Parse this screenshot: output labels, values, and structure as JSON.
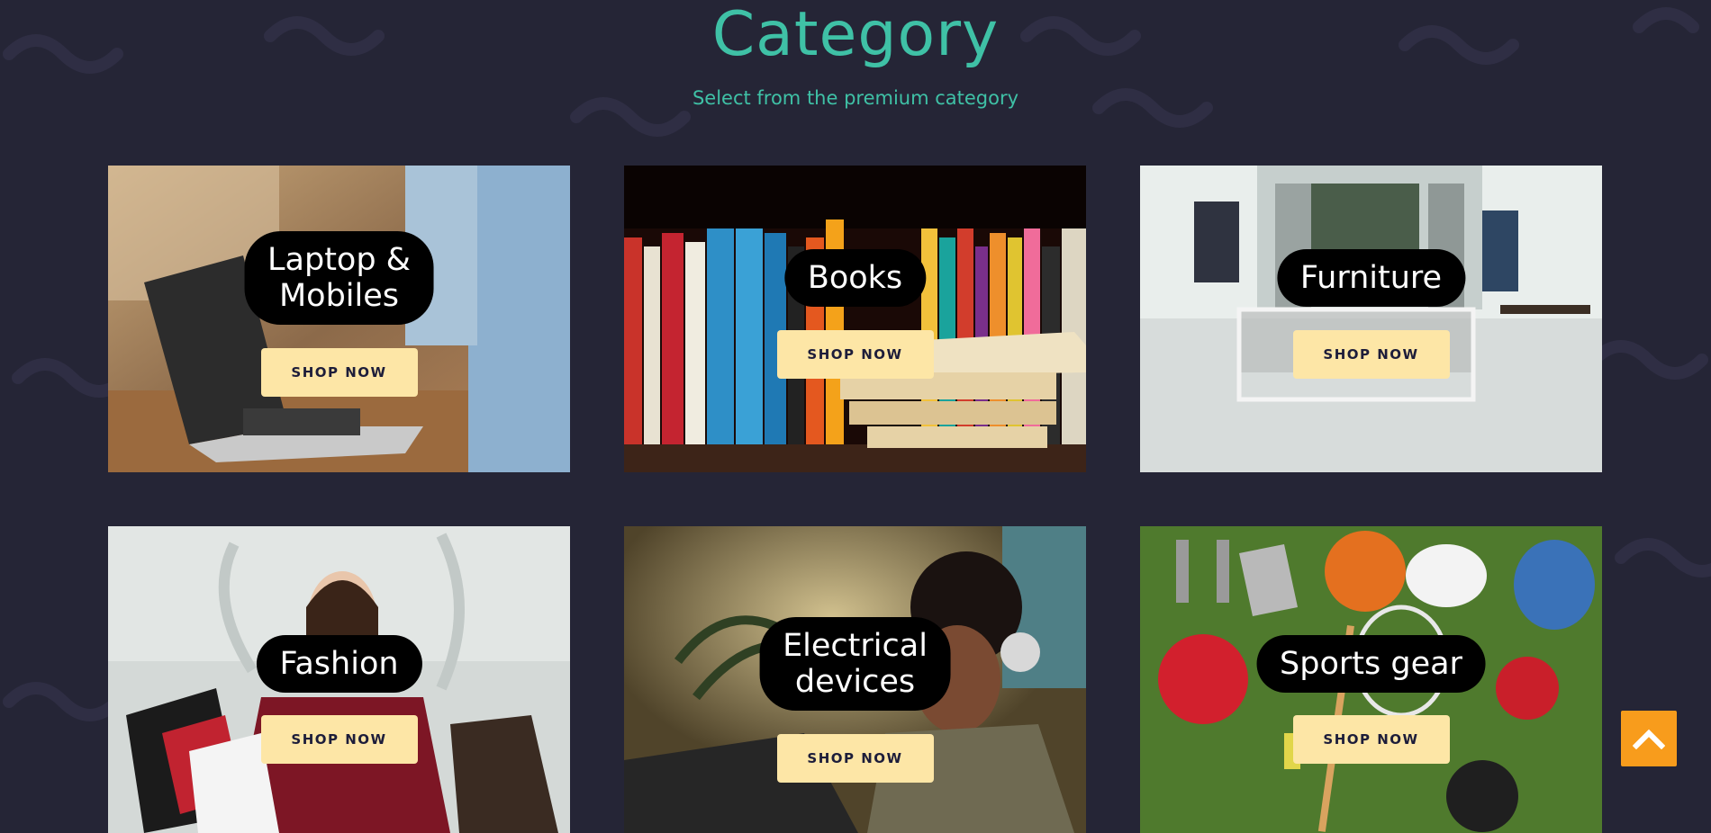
{
  "header": {
    "title": "Category",
    "subtitle": "Select from the premium category"
  },
  "categories": [
    {
      "label_lines": [
        "Laptop &",
        "Mobiles"
      ],
      "button": "SHOP NOW",
      "image": "laptop-photo"
    },
    {
      "label_lines": [
        "Books"
      ],
      "button": "SHOP NOW",
      "image": "books-photo"
    },
    {
      "label_lines": [
        "Furniture"
      ],
      "button": "SHOP NOW",
      "image": "furniture-photo"
    },
    {
      "label_lines": [
        "Fashion"
      ],
      "button": "SHOP NOW",
      "image": "fashion-photo"
    },
    {
      "label_lines": [
        "Electrical",
        "devices"
      ],
      "button": "SHOP NOW",
      "image": "headphones-photo"
    },
    {
      "label_lines": [
        "Sports gear"
      ],
      "button": "SHOP NOW",
      "image": "sports-photo"
    }
  ],
  "scroll_top": {
    "icon": "chevron-up-icon"
  },
  "colors": {
    "background": "#252536",
    "accent": "#3fc1a6",
    "button": "#fde6a6",
    "scroll_top": "#f89c1c"
  }
}
